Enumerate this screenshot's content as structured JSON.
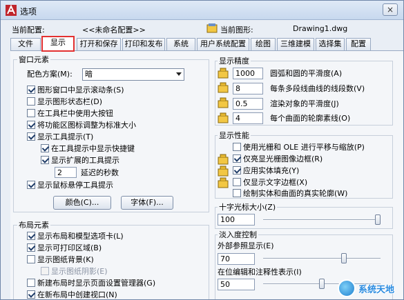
{
  "window": {
    "title": "选项",
    "close_glyph": "×"
  },
  "header": {
    "profile_label": "当前配置:",
    "profile_value": "<<未命名配置>>",
    "drawing_label": "当前图形:",
    "drawing_value": "Drawing1.dwg"
  },
  "tabs": [
    {
      "label": "文件"
    },
    {
      "label": "显示",
      "active": true
    },
    {
      "label": "打开和保存"
    },
    {
      "label": "打印和发布"
    },
    {
      "label": "系统"
    },
    {
      "label": "用户系统配置"
    },
    {
      "label": "绘图"
    },
    {
      "label": "三维建模"
    },
    {
      "label": "选择集"
    },
    {
      "label": "配置"
    }
  ],
  "window_elements": {
    "title": "窗口元素",
    "color_scheme_label": "配色方案(M):",
    "color_scheme_value": "暗",
    "checkboxes": [
      {
        "label": "图形窗口中显示滚动条(S)",
        "checked": true
      },
      {
        "label": "显示图形状态栏(D)",
        "checked": false
      },
      {
        "label": "在工具栏中使用大按钮",
        "checked": false
      },
      {
        "label": "将功能区图标调整为标准大小",
        "checked": true
      },
      {
        "label": "显示工具提示(T)",
        "checked": true
      },
      {
        "label": "在工具提示中显示快捷键",
        "checked": true
      },
      {
        "label": "显示扩展的工具提示",
        "checked": true
      }
    ],
    "delay_value": "2",
    "delay_label": "延迟的秒数",
    "rollover_label": "显示鼠标悬停工具提示",
    "rollover_checked": true,
    "colors_button": "颜色(C)...",
    "fonts_button": "字体(F)..."
  },
  "layout_elements": {
    "title": "布局元素",
    "checkboxes": [
      {
        "label": "显示布局和模型选项卡(L)",
        "checked": true
      },
      {
        "label": "显示可打印区域(B)",
        "checked": true
      },
      {
        "label": "显示图纸背景(K)",
        "checked": false
      },
      {
        "label": "显示图纸阴影(E)",
        "checked": false,
        "disabled": true
      },
      {
        "label": "新建布局时显示页面设置管理器(G)",
        "checked": false
      },
      {
        "label": "在新布局中创建视口(N)",
        "checked": true
      }
    ]
  },
  "display_resolution": {
    "title": "显示精度",
    "rows": [
      {
        "value": "1000",
        "label": "圆弧和圆的平滑度(A)"
      },
      {
        "value": "8",
        "label": "每条多段线曲线的线段数(V)"
      },
      {
        "value": "0.5",
        "label": "渲染对象的平滑度(J)"
      },
      {
        "value": "4",
        "label": "每个曲面的轮廓素线(O)"
      }
    ]
  },
  "display_performance": {
    "title": "显示性能",
    "rows": [
      {
        "label": "使用光栅和 OLE 进行平移与缩放(P)",
        "checked": false
      },
      {
        "label": "仅亮显光栅图像边框(R)",
        "checked": true
      },
      {
        "label": "应用实体填充(Y)",
        "checked": true
      },
      {
        "label": "仅显示文字边框(X)",
        "checked": false
      },
      {
        "label": "绘制实体和曲面的真实轮廓(W)",
        "checked": false
      }
    ]
  },
  "crosshair": {
    "title": "十字光标大小(Z)",
    "value": "100",
    "level_percent": 100
  },
  "fade_control": {
    "title": "淡入度控制",
    "xref_label": "外部参照显示(E)",
    "xref_value": "70",
    "xref_level": 70,
    "inplace_label": "在位编辑和注释性表示(I)",
    "inplace_value": "50",
    "inplace_level": 50
  },
  "watermark": {
    "text": "系统天地"
  },
  "colors": {
    "accent": "#e33030",
    "brand_blue": "#2a8be0"
  }
}
